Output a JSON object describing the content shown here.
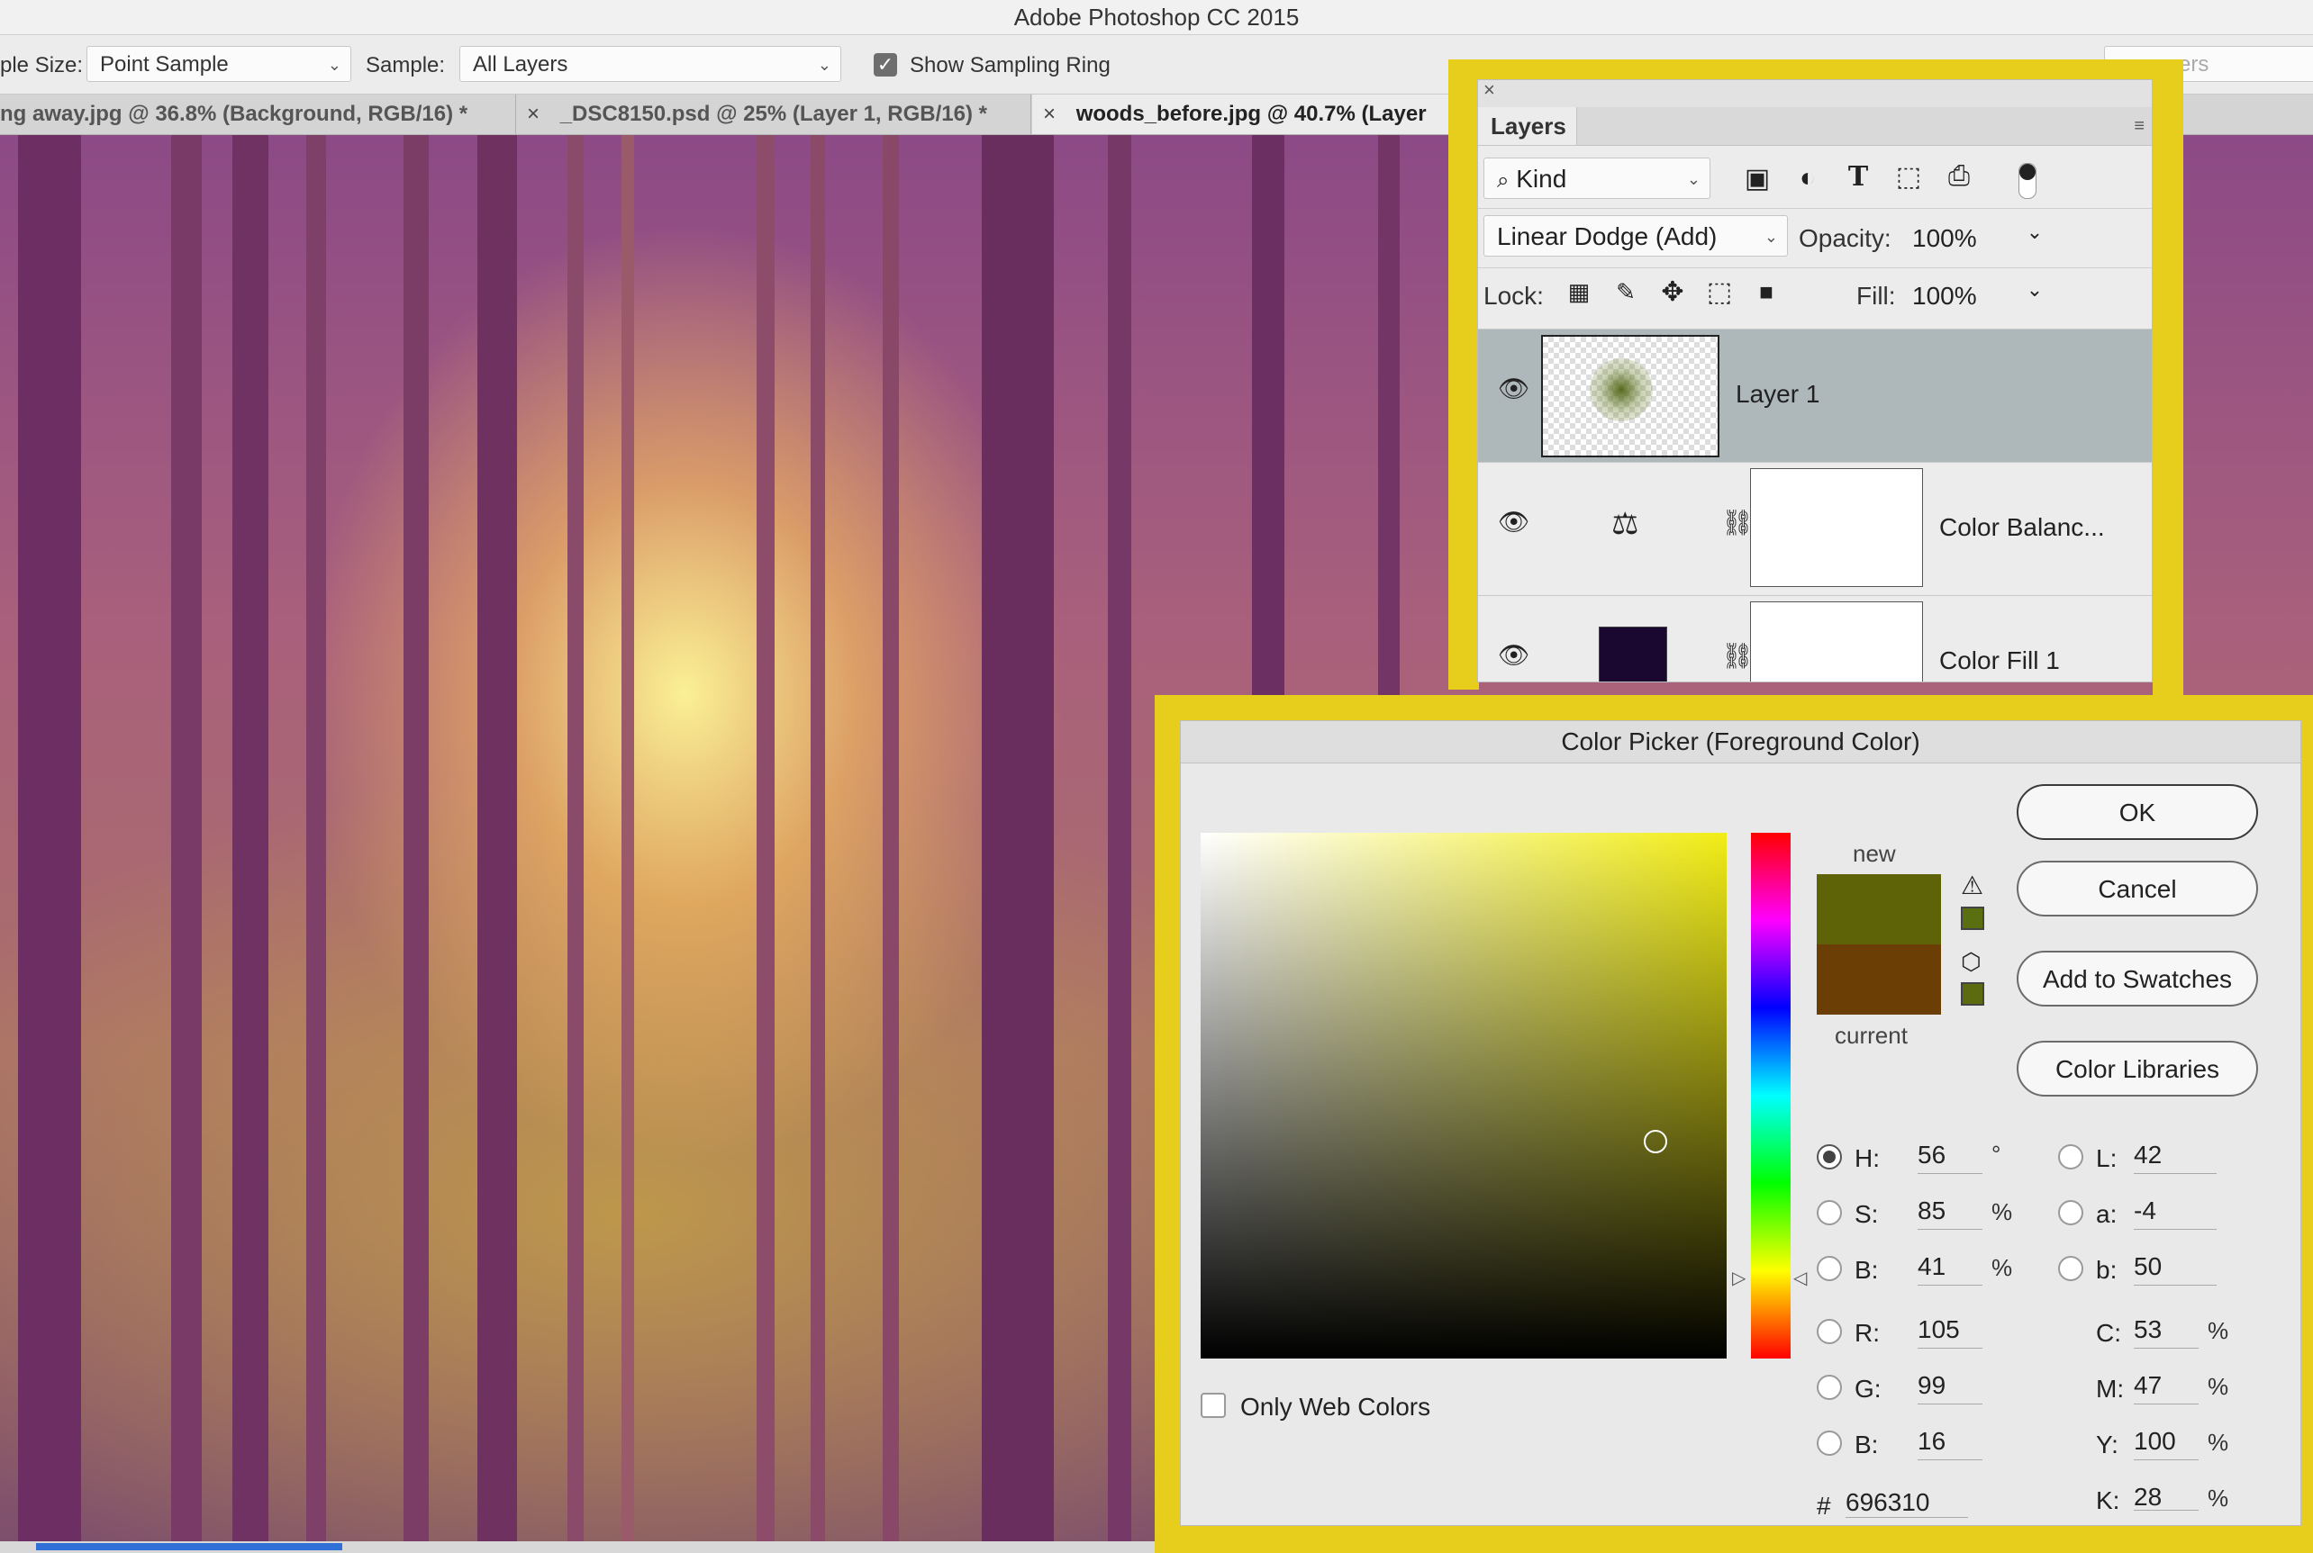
{
  "app_title": "Adobe Photoshop CC 2015",
  "options_bar": {
    "sample_size_label": "ple Size:",
    "sample_size_value": "Point Sample",
    "sample_label": "Sample:",
    "sample_value": "All Layers",
    "show_sampling_ring_label": "Show Sampling Ring",
    "show_sampling_ring_checked": true,
    "right_search_placeholder": "ers"
  },
  "document_tabs": [
    {
      "label": "ng away.jpg @ 36.8% (Background, RGB/16) *",
      "active": false
    },
    {
      "label": "_DSC8150.psd @ 25% (Layer 1, RGB/16) *",
      "active": false
    },
    {
      "label": "woods_before.jpg @ 40.7% (Layer",
      "active": true
    }
  ],
  "tab_close_glyph": "×",
  "layers_panel": {
    "tab_label": "Layers",
    "close_glyph": "×",
    "menu_glyph": "≡",
    "kind_label": "Kind",
    "blend_mode": "Linear Dodge (Add)",
    "opacity_label": "Opacity:",
    "opacity_value": "100%",
    "lock_label": "Lock:",
    "fill_label": "Fill:",
    "fill_value": "100%",
    "filter_icons": [
      "image-filter-icon",
      "adjustment-filter-icon",
      "type-filter-icon",
      "shape-filter-icon",
      "smart-object-filter-icon"
    ],
    "lock_icons": [
      "lock-transparent-icon",
      "lock-image-icon",
      "lock-position-icon",
      "lock-artboard-icon",
      "lock-all-icon"
    ],
    "layers": [
      {
        "name": "Layer 1",
        "selected": true,
        "visible": true
      },
      {
        "name": "Color Balanc...",
        "selected": false,
        "visible": true
      },
      {
        "name": "Color Fill 1",
        "selected": false,
        "visible": true
      }
    ]
  },
  "color_picker": {
    "title": "Color Picker (Foreground Color)",
    "buttons": {
      "ok": "OK",
      "cancel": "Cancel",
      "add_to_swatches": "Add to Swatches",
      "color_libraries": "Color Libraries"
    },
    "new_label": "new",
    "current_label": "current",
    "new_color": "#5e6308",
    "current_color": "#6b3e06",
    "only_web_colors_label": "Only Web Colors",
    "only_web_colors_checked": false,
    "hsb": {
      "h": {
        "label": "H:",
        "value": "56",
        "unit": "°",
        "selected": true
      },
      "s": {
        "label": "S:",
        "value": "85",
        "unit": "%",
        "selected": false
      },
      "b": {
        "label": "B:",
        "value": "41",
        "unit": "%",
        "selected": false
      }
    },
    "rgb": {
      "r": {
        "label": "R:",
        "value": "105"
      },
      "g": {
        "label": "G:",
        "value": "99"
      },
      "b": {
        "label": "B:",
        "value": "16"
      }
    },
    "lab": {
      "l": {
        "label": "L:",
        "value": "42"
      },
      "a": {
        "label": "a:",
        "value": "-4"
      },
      "b": {
        "label": "b:",
        "value": "50"
      }
    },
    "cmyk": {
      "c": {
        "label": "C:",
        "value": "53",
        "unit": "%"
      },
      "m": {
        "label": "M:",
        "value": "47",
        "unit": "%"
      },
      "y": {
        "label": "Y:",
        "value": "100",
        "unit": "%"
      },
      "k": {
        "label": "K:",
        "value": "28",
        "unit": "%"
      }
    },
    "hex_label": "#",
    "hex_value": "696310"
  },
  "colors": {
    "highlight_frame": "#e7ce1c",
    "layer_selected": "#aeb8bb",
    "color_fill_thumb": "#1b0830"
  }
}
